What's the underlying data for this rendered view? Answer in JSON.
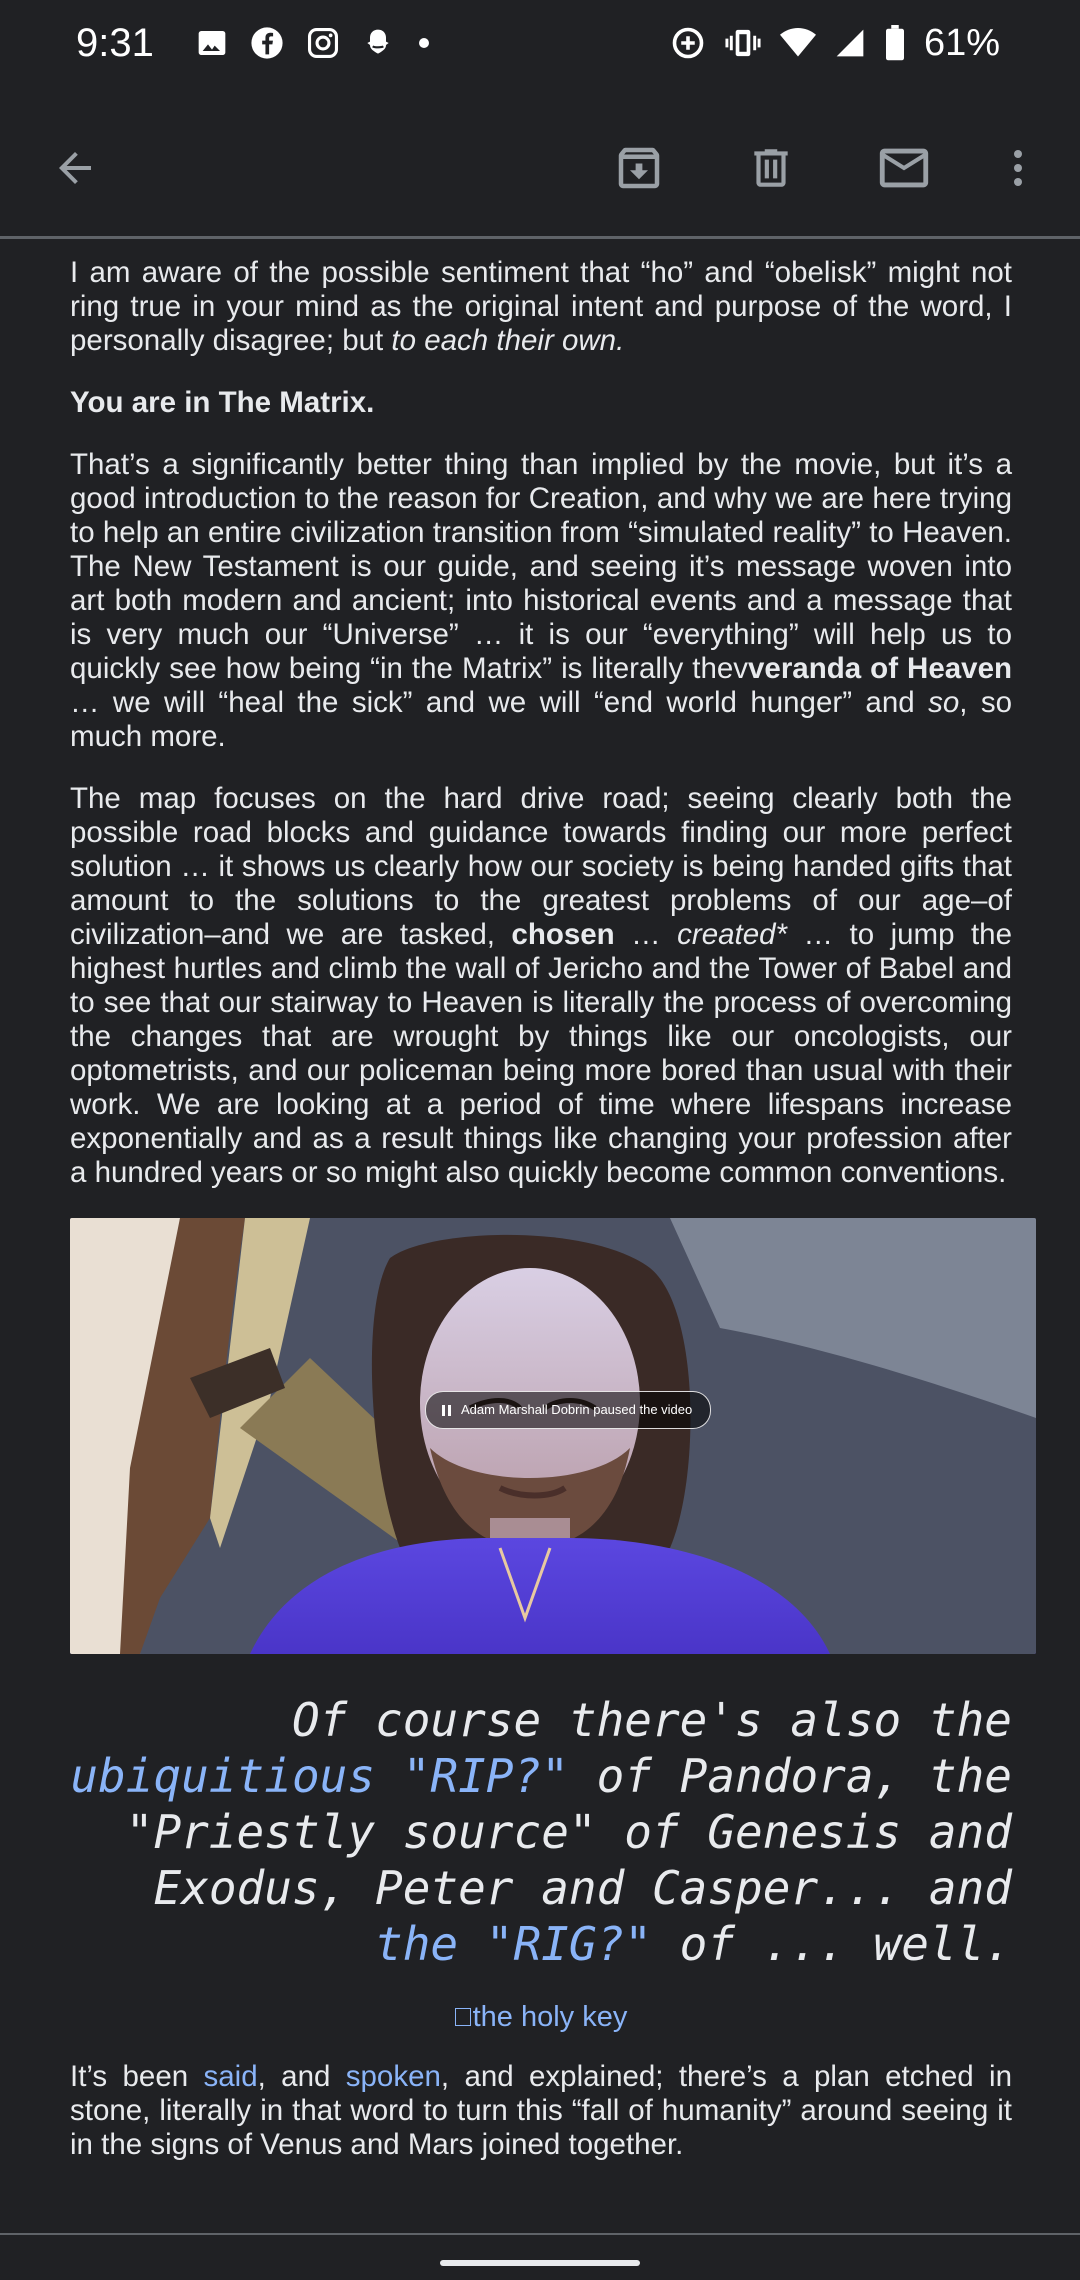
{
  "status_bar": {
    "time": "9:31",
    "left_icons": [
      "image-icon",
      "facebook-icon",
      "instagram-icon",
      "snapchat-icon",
      "dot-icon"
    ],
    "right_icons": [
      "data-saver-icon",
      "vibrate-icon",
      "wifi-icon",
      "signal-icon",
      "battery-icon"
    ],
    "battery_text": "61%"
  },
  "app_bar": {
    "icons": [
      "back-arrow-icon",
      "archive-icon",
      "delete-icon",
      "mark-unread-icon",
      "more-vert-icon"
    ]
  },
  "email": {
    "p1_a": "I am aware of the possible sentiment that “ho” and “obelisk” might not ring true in your mind as the original intent and purpose of the word, I personally disagree; but ",
    "p1_b": "to each their own.",
    "heading": "You are in The Matrix.",
    "p2_a": "That’s a significantly better thing than implied by the movie, but it’s a good introduction to the reason for Creation, and why we are here trying to help an entire civilization transition from “simulated reality” to Heaven. The New Testament is our guide, and seeing it’s message woven into art both modern and ancient; into historical events and a message that is very much our “Universe” … it is our “everything” will help us to quickly see how being “in the Matrix” is literally thev",
    "p2_b": "veranda of Heaven",
    "p2_c": " … we will “heal the sick” and we will “end world hunger” and ",
    "p2_d": "so",
    "p2_e": ", so much more.",
    "p3_a": "The map focuses on the hard drive road; seeing clearly both the possible road blocks and guidance towards finding our more perfect solution … it shows us clearly how our society is being handed gifts that amount to the solutions to the greatest problems of our age–of civilization–and we are tasked, ",
    "p3_b": "chosen",
    "p3_c": " … ",
    "p3_d": "created*",
    "p3_e": " … to jump the highest hurtles and climb the wall of Jericho and the Tower of Babel and to see that our stairway to Heaven is literally the process of overcoming the changes that are wrought by things like our oncologists, our optometrists, and our policeman being more bored than usual with their work. We are looking at a period of time where lifespans increase exponentially and as a result things like changing your profession after a hundred years or so might also quickly become common conventions.",
    "video_overlay": "Adam Marshall Dobrin paused the video",
    "quote_a": "Of course there's also the ",
    "quote_link1": "ubiquitious \"RIP?\"",
    "quote_b": " of Pandora, the \"Priestly source\" of Genesis and Exodus, Peter and Casper... and ",
    "quote_link2": "the \"RIG?\"",
    "quote_c": " of ... well.",
    "broken_image_alt": "the holy key",
    "p4_a": "It’s been ",
    "p4_link1": "said",
    "p4_b": ", and ",
    "p4_link2": "spoken",
    "p4_c": ", and explained; there’s a plan etched in stone, literally in that word to turn this “fall of humanity” around seeing it in the signs of Venus and Mars joined together."
  }
}
